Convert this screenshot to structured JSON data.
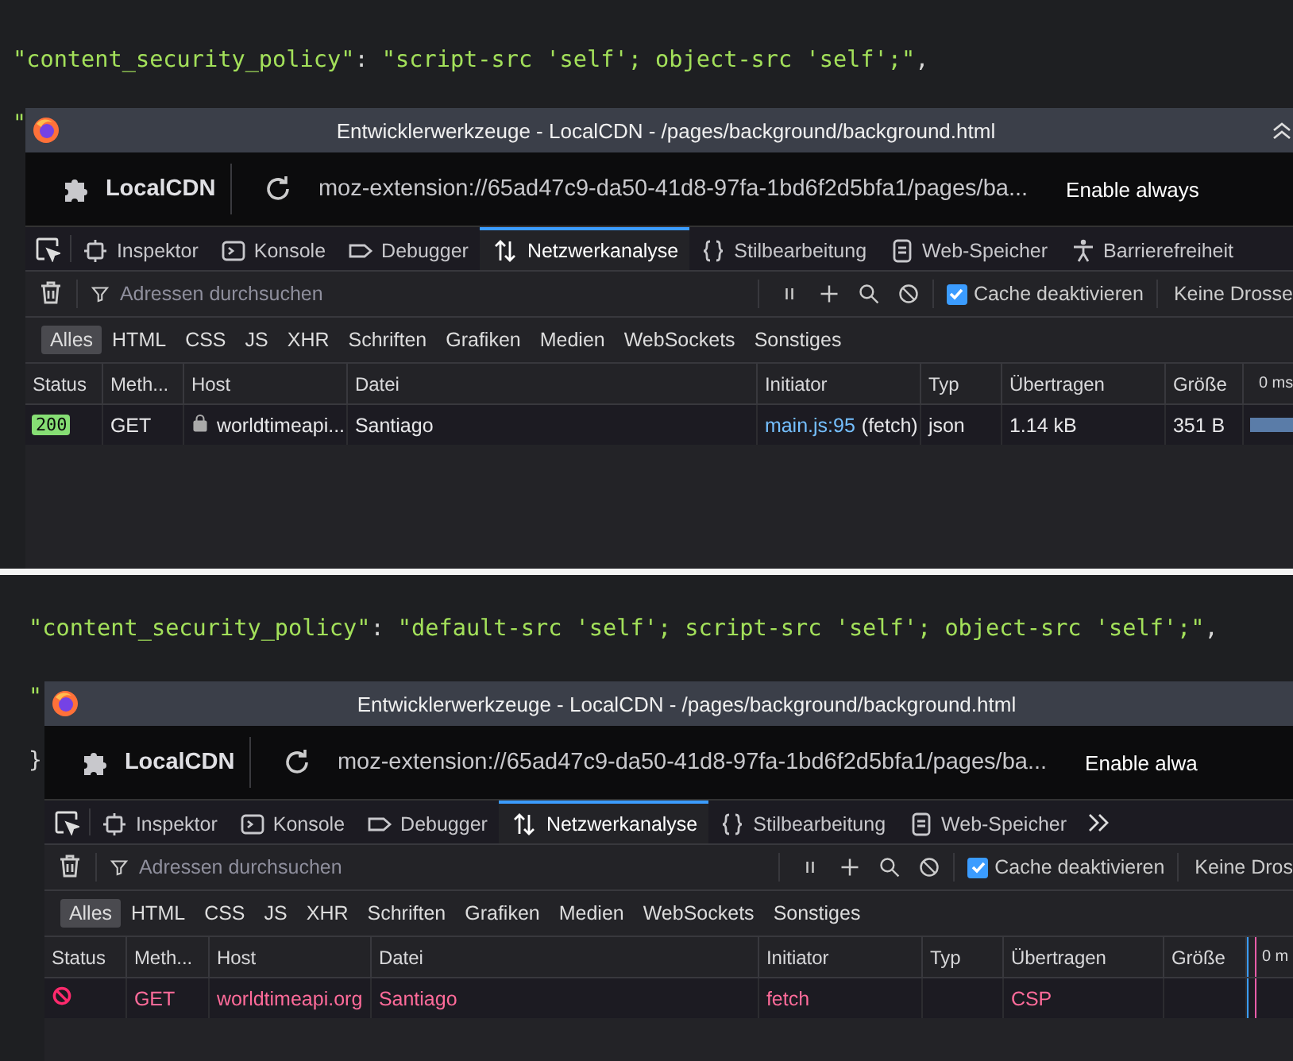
{
  "panels": [
    {
      "code_line": [
        {
          "kind": "string",
          "text": "\"content_security_policy\""
        },
        {
          "kind": "punct",
          "text": ": "
        },
        {
          "kind": "string",
          "text": "\"script-src 'self'; object-src 'self';\""
        },
        {
          "kind": "punct",
          "text": ","
        }
      ],
      "gutter_fragments": [
        "\""
      ],
      "window": {
        "title": "Entwicklerwerkzeuge - LocalCDN - /pages/background/background.html",
        "collapse_button": true,
        "extension_name": "LocalCDN",
        "url": "moz-extension://65ad47c9-da50-41d8-97fa-1bd6f2d5bfa1/pages/ba...",
        "enable_text": "Enable always",
        "tabs": [
          {
            "label": "Inspektor",
            "selected": false
          },
          {
            "label": "Konsole",
            "selected": false
          },
          {
            "label": "Debugger",
            "selected": false
          },
          {
            "label": "Netzwerkanalyse",
            "selected": true
          },
          {
            "label": "Stilbearbeitung",
            "selected": false
          },
          {
            "label": "Web-Speicher",
            "selected": false
          },
          {
            "label": "Barrierefreiheit",
            "selected": false
          }
        ],
        "tabs_overflow": false,
        "filter": {
          "placeholder": "Adressen durchsuchen"
        },
        "cache": {
          "checked": true,
          "label": "Cache deaktivieren"
        },
        "throttle": "Keine Drosse",
        "type_filters": [
          {
            "label": "Alles",
            "selected": true
          },
          {
            "label": "HTML",
            "selected": false
          },
          {
            "label": "CSS",
            "selected": false
          },
          {
            "label": "JS",
            "selected": false
          },
          {
            "label": "XHR",
            "selected": false
          },
          {
            "label": "Schriften",
            "selected": false
          },
          {
            "label": "Grafiken",
            "selected": false
          },
          {
            "label": "Medien",
            "selected": false
          },
          {
            "label": "WebSockets",
            "selected": false
          },
          {
            "label": "Sonstiges",
            "selected": false
          }
        ],
        "columns": [
          "Status",
          "Meth...",
          "Host",
          "Datei",
          "Initiator",
          "Typ",
          "Übertragen",
          "Größe",
          "0 ms"
        ],
        "rows": [
          {
            "kind": "ok",
            "status": "200",
            "method": "GET",
            "secure": true,
            "host": "worldtimeapi...",
            "file": "Santiago",
            "initiator_link": "main.js:95",
            "initiator": "(fetch)",
            "type": "json",
            "transferred": "1.14 kB",
            "size": "351 B"
          }
        ]
      }
    },
    {
      "code_line": [
        {
          "kind": "string",
          "text": "\"content_security_policy\""
        },
        {
          "kind": "punct",
          "text": ": "
        },
        {
          "kind": "string",
          "text": "\"default-src 'self'; script-src 'self'; object-src 'self';\""
        },
        {
          "kind": "punct",
          "text": ","
        }
      ],
      "gutter_fragments": [
        "\"",
        "}"
      ],
      "window": {
        "title": "Entwicklerwerkzeuge - LocalCDN - /pages/background/background.html",
        "collapse_button": false,
        "extension_name": "LocalCDN",
        "url": "moz-extension://65ad47c9-da50-41d8-97fa-1bd6f2d5bfa1/pages/ba...",
        "enable_text": "Enable alwa",
        "tabs": [
          {
            "label": "Inspektor",
            "selected": false
          },
          {
            "label": "Konsole",
            "selected": false
          },
          {
            "label": "Debugger",
            "selected": false
          },
          {
            "label": "Netzwerkanalyse",
            "selected": true
          },
          {
            "label": "Stilbearbeitung",
            "selected": false
          },
          {
            "label": "Web-Speicher",
            "selected": false
          }
        ],
        "tabs_overflow": true,
        "filter": {
          "placeholder": "Adressen durchsuchen"
        },
        "cache": {
          "checked": true,
          "label": "Cache deaktivieren"
        },
        "throttle": "Keine Dros",
        "type_filters": [
          {
            "label": "Alles",
            "selected": true
          },
          {
            "label": "HTML",
            "selected": false
          },
          {
            "label": "CSS",
            "selected": false
          },
          {
            "label": "JS",
            "selected": false
          },
          {
            "label": "XHR",
            "selected": false
          },
          {
            "label": "Schriften",
            "selected": false
          },
          {
            "label": "Grafiken",
            "selected": false
          },
          {
            "label": "Medien",
            "selected": false
          },
          {
            "label": "WebSockets",
            "selected": false
          },
          {
            "label": "Sonstiges",
            "selected": false
          }
        ],
        "columns": [
          "Status",
          "Meth...",
          "Host",
          "Datei",
          "Initiator",
          "Typ",
          "Übertragen",
          "Größe",
          "0 m"
        ],
        "rows": [
          {
            "kind": "blocked",
            "method": "GET",
            "secure": false,
            "host": "worldtimeapi.org",
            "file": "Santiago",
            "initiator": "fetch",
            "transferred": "CSP"
          }
        ]
      }
    }
  ]
}
